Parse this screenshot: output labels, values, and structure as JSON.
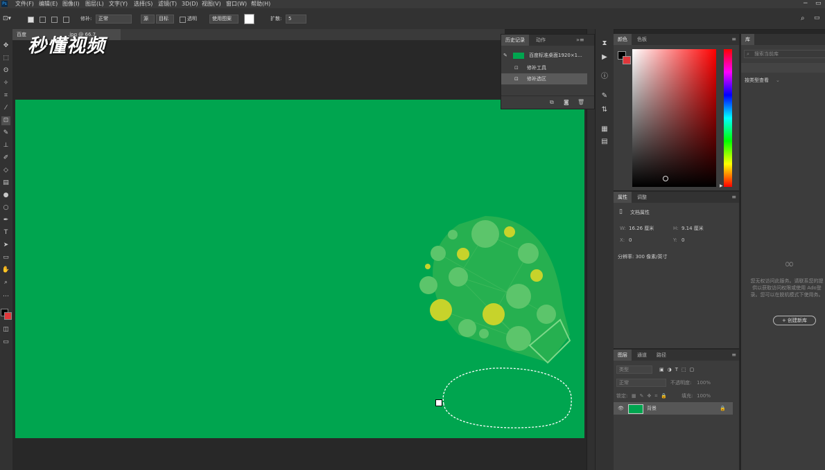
{
  "menu": {
    "items": [
      "文件(F)",
      "编辑(E)",
      "图像(I)",
      "图层(L)",
      "文字(Y)",
      "选择(S)",
      "滤镜(T)",
      "3D(D)",
      "视图(V)",
      "窗口(W)",
      "帮助(H)"
    ],
    "window_controls": [
      "−",
      "▭"
    ]
  },
  "watermark": "秒懂视频",
  "options": {
    "repair_label": "修补:",
    "mode_value": "正常",
    "source_label": "源",
    "target_label": "目标",
    "transparent_label": "透明",
    "use_pattern_label": "使用图案",
    "diffusion_label": "扩散:",
    "diffusion_value": "5"
  },
  "document": {
    "tab_prefix": "百度",
    "tab_suffix": ".jpg @ 66.7",
    "canvas_color": "#00a54f"
  },
  "history": {
    "tab_history": "历史记录",
    "tab_actions": "动作",
    "rows": [
      "百度标准桌面1920×1...",
      "修补工具",
      "修补选区"
    ]
  },
  "color_panel": {
    "tab_color": "颜色",
    "tab_swatches": "色板",
    "foreground": "#000000",
    "background": "#e0373b"
  },
  "properties": {
    "tab_properties": "属性",
    "tab_adjust": "调整",
    "doc_title": "文档属性",
    "w_label": "W:",
    "w_value": "16.26 厘米",
    "h_label": "H:",
    "h_value": "9.14 厘米",
    "x_label": "X:",
    "x_value": "0",
    "y_label": "Y:",
    "y_value": "0",
    "resolution": "分辨率: 300 像素/英寸"
  },
  "layers": {
    "tab_layers": "图层",
    "tab_channels": "通道",
    "tab_paths": "路径",
    "filter_placeholder": "类型",
    "blend_mode": "正常",
    "opacity_label": "不透明度:",
    "opacity_value": "100%",
    "lock_label": "锁定:",
    "fill_label": "填充:",
    "fill_value": "100%",
    "layer_name": "背景"
  },
  "library": {
    "tab": "库",
    "search_placeholder": "搜索当前库",
    "view_by": "按类型查看",
    "message": "您无权访问此服务。请联系您的提供以获取访问权限或使用 Ado登录。您可以在脱机模式下使用务。",
    "create_button": "+ 创建新库"
  }
}
